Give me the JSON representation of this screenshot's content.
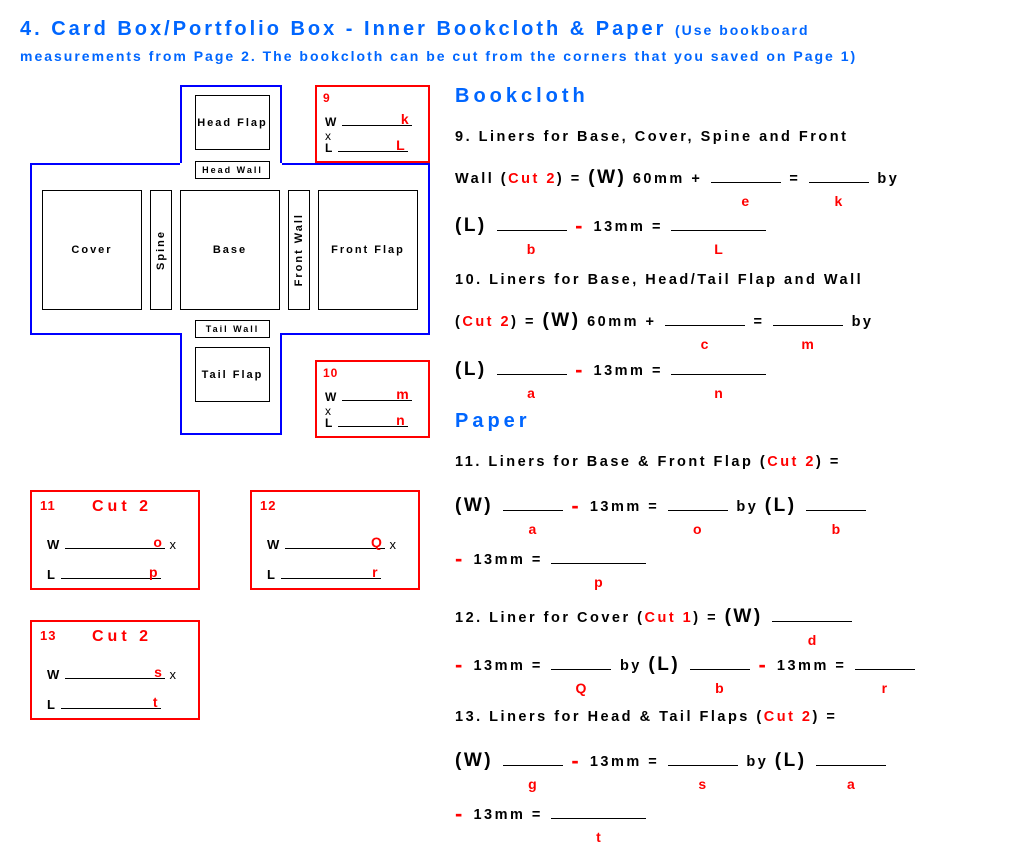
{
  "title_main": "4. Card Box/Portfolio Box - Inner Bookcloth & Paper",
  "title_paren1": "(Use bookboard",
  "title_paren2": "measurements from Page 2. The bookcloth can be cut from the corners that you saved on Page 1)",
  "diagram": {
    "head_flap": "Head Flap",
    "head_wall": "Head Wall",
    "cover": "Cover",
    "base": "Base",
    "front_flap": "Front Flap",
    "spine": "Spine",
    "front_wall": "Front Wall",
    "tail_wall": "Tail Wall",
    "tail_flap": "Tail Flap"
  },
  "box9": {
    "num": "9",
    "W": "W",
    "k": "k",
    "L": "L",
    "Ltag": "L",
    "x": "x"
  },
  "box10": {
    "num": "10",
    "W": "W",
    "m": "m",
    "L": "L",
    "n": "n",
    "x": "x"
  },
  "cut11": {
    "num": "11",
    "cut": "Cut 2",
    "W": "W",
    "o": "o",
    "L": "L",
    "p": "p",
    "x": "x"
  },
  "cut12": {
    "num": "12",
    "W": "W",
    "Q": "Q",
    "L": "L",
    "r": "r",
    "x": "x"
  },
  "cut13": {
    "num": "13",
    "cut": "Cut 2",
    "W": "W",
    "s": "s",
    "L": "L",
    "t": "t",
    "x": "x"
  },
  "bookcloth_head": "Bookcloth",
  "paper_head": "Paper",
  "eq9": {
    "t1": "9. Liners for Base, Cover, Spine and Front",
    "t2": "Wall (",
    "cut": "Cut 2",
    "t3": ") = ",
    "W": "(W)",
    "v60": " 60mm + ",
    "eq": " = ",
    "by": " by",
    "L": "(L) ",
    "m13": " 13mm = ",
    "tags": {
      "e": "e",
      "k": "k",
      "b": "b",
      "L": "L"
    }
  },
  "eq10": {
    "t1": "10. Liners for Base, Head/Tail Flap and Wall",
    "t2": "(",
    "cut": "Cut 2",
    "t3": ") = ",
    "W": "(W)",
    "v60": " 60mm + ",
    "eq": " = ",
    "by": " by",
    "L": "(L) ",
    "m13": " 13mm = ",
    "tags": {
      "c": "c",
      "m": "m",
      "a": "a",
      "n": "n"
    }
  },
  "eq11": {
    "t1": "11. Liners for Base & Front Flap (",
    "cut": "Cut 2",
    "t2": ") =",
    "W": "(W) ",
    "m13a": " 13mm = ",
    "by": " by ",
    "L": "(L) ",
    "m13b": " 13mm = ",
    "tags": {
      "a": "a",
      "o": "o",
      "b": "b",
      "p": "p"
    }
  },
  "eq12": {
    "t1": "12. Liner for Cover (",
    "cut": "Cut 1",
    "t2": ") = ",
    "W": "(W) ",
    "m13a": " 13mm = ",
    "by": " by ",
    "L": "(L) ",
    "m13b": " 13mm = ",
    "tags": {
      "d": "d",
      "Q": "Q",
      "b": "b",
      "r": "r"
    }
  },
  "eq13": {
    "t1": "13. Liners for Head & Tail Flaps (",
    "cut": "Cut 2",
    "t2": ") =",
    "W": "(W) ",
    "m13a": " 13mm = ",
    "by": " by ",
    "L": "(L) ",
    "m13b": " 13mm = ",
    "tags": {
      "g": "g",
      "s": "s",
      "a": "a",
      "t": "t"
    }
  }
}
